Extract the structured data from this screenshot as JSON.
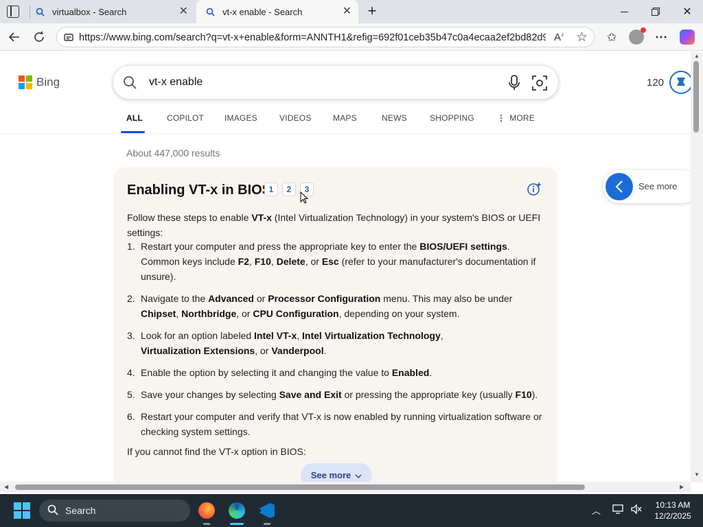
{
  "browser": {
    "tabs": [
      {
        "title": "virtualbox - Search",
        "active": false,
        "icon": "search-icon"
      },
      {
        "title": "vt-x enable - Search",
        "active": true,
        "icon": "search-icon"
      }
    ],
    "url": "https://www.bing.com/search?q=vt-x+enable&form=ANNTH1&refig=692f01ceb35b47c0a4ecaa2ef2bd82d9..."
  },
  "bing": {
    "logo_text": "Bing",
    "query": "vt-x enable",
    "points": "120",
    "scopes": [
      "ALL",
      "COPILOT",
      "IMAGES",
      "VIDEOS",
      "MAPS",
      "NEWS",
      "SHOPPING",
      "MORE"
    ],
    "result_count": "About 447,000 results"
  },
  "answer": {
    "title": "Enabling VT-x in BIOS",
    "citations": [
      "1",
      "2",
      "3"
    ],
    "intro": [
      {
        "t": "Follow these steps to enable "
      },
      {
        "t": "VT-x",
        "b": true
      },
      {
        "t": " (Intel Virtualization Technology) in your system's BIOS or UEFI settings:"
      }
    ],
    "steps": [
      {
        "num": "1.",
        "parts": [
          {
            "t": "Restart your computer and press the appropriate key to enter the "
          },
          {
            "t": "BIOS/UEFI settings",
            "b": true
          },
          {
            "t": ". Common keys include "
          },
          {
            "t": "F2",
            "b": true
          },
          {
            "t": ", "
          },
          {
            "t": "F10",
            "b": true
          },
          {
            "t": ", "
          },
          {
            "t": "Delete",
            "b": true
          },
          {
            "t": ", or "
          },
          {
            "t": "Esc",
            "b": true
          },
          {
            "t": " (refer to your manufacturer's documentation if unsure)."
          }
        ]
      },
      {
        "num": "2.",
        "parts": [
          {
            "t": "Navigate to the "
          },
          {
            "t": "Advanced",
            "b": true
          },
          {
            "t": " or "
          },
          {
            "t": "Processor Configuration",
            "b": true
          },
          {
            "t": " menu. This may also be under "
          },
          {
            "t": "Chipset",
            "b": true
          },
          {
            "t": ", "
          },
          {
            "t": "Northbridge",
            "b": true
          },
          {
            "t": ", or "
          },
          {
            "t": "CPU Configuration",
            "b": true
          },
          {
            "t": ", depending on your system."
          }
        ]
      },
      {
        "num": "3.",
        "parts": [
          {
            "t": "Look for an option labeled "
          },
          {
            "t": "Intel VT-x",
            "b": true
          },
          {
            "t": ", "
          },
          {
            "t": "Intel Virtualization Technology",
            "b": true
          },
          {
            "t": ", "
          },
          {
            "t": "Virtualization Extensions",
            "b": true
          },
          {
            "t": ", or "
          },
          {
            "t": "Vanderpool",
            "b": true
          },
          {
            "t": "."
          }
        ]
      },
      {
        "num": "4.",
        "parts": [
          {
            "t": "Enable the option by selecting it and changing the value to "
          },
          {
            "t": "Enabled",
            "b": true
          },
          {
            "t": "."
          }
        ]
      },
      {
        "num": "5.",
        "parts": [
          {
            "t": "Save your changes by selecting "
          },
          {
            "t": "Save and Exit",
            "b": true
          },
          {
            "t": " or pressing the appropriate key (usually "
          },
          {
            "t": "F10",
            "b": true
          },
          {
            "t": ")."
          }
        ]
      },
      {
        "num": "6.",
        "parts": [
          {
            "t": "Restart your computer and verify that VT-x is now enabled by running virtualization software or checking system settings."
          }
        ]
      }
    ],
    "outro": "If you cannot find the VT-x option in BIOS:",
    "see_more": "See more"
  },
  "side_panel": {
    "label": "See more"
  },
  "taskbar": {
    "search_label": "Search",
    "time": "10:13 AM",
    "date": "12/2/2025"
  },
  "colors": {
    "accent": "#174ae4",
    "bing_blue": "#1b6bd8",
    "card_bg": "#f8f5f1"
  }
}
